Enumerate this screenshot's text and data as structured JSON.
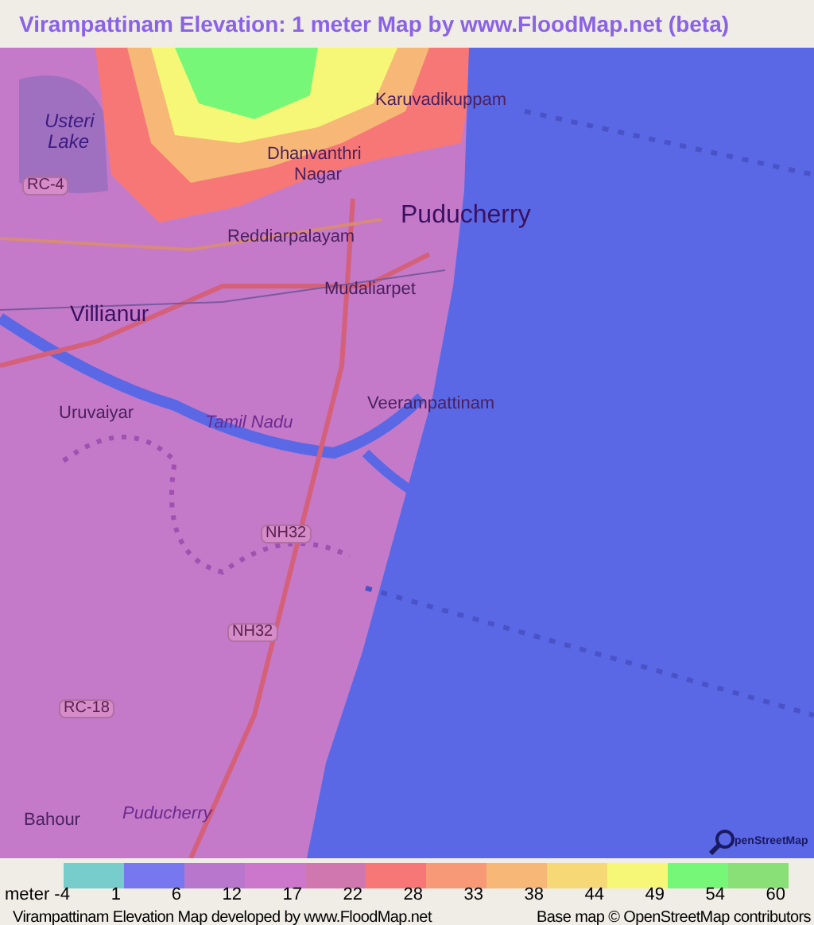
{
  "title": "Virampattinam Elevation: 1 meter Map by www.FloodMap.net (beta)",
  "map": {
    "labels": [
      {
        "text": "Usteri",
        "kind": "water"
      },
      {
        "text": "Lake",
        "kind": "water"
      },
      {
        "text": "Karuvadikuppam",
        "kind": "place"
      },
      {
        "text": "Dhanvanthri",
        "kind": "place"
      },
      {
        "text": "Nagar",
        "kind": "place"
      },
      {
        "text": "RC-4",
        "kind": "road"
      },
      {
        "text": "Puducherry",
        "kind": "city"
      },
      {
        "text": "Reddiarpalayam",
        "kind": "place"
      },
      {
        "text": "Mudaliarpet",
        "kind": "place"
      },
      {
        "text": "Villianur",
        "kind": "town"
      },
      {
        "text": "Veerampattinam",
        "kind": "place"
      },
      {
        "text": "Uruvaiyar",
        "kind": "place"
      },
      {
        "text": "Tamil Nadu",
        "kind": "region"
      },
      {
        "text": "NH32",
        "kind": "road"
      },
      {
        "text": "NH32",
        "kind": "road"
      },
      {
        "text": "RC-18",
        "kind": "road"
      },
      {
        "text": "Bahour",
        "kind": "place"
      },
      {
        "text": "Puducherry",
        "kind": "region"
      }
    ],
    "logo_text": "penStreetMap"
  },
  "legend": {
    "swatches": [
      {
        "color": "#76cdcb"
      },
      {
        "color": "#7777f0"
      },
      {
        "color": "#b877cc"
      },
      {
        "color": "#cc77cc"
      },
      {
        "color": "#d177b0"
      },
      {
        "color": "#f77777"
      },
      {
        "color": "#f79877"
      },
      {
        "color": "#f7b877"
      },
      {
        "color": "#f7d877"
      },
      {
        "color": "#f7f777"
      },
      {
        "color": "#77f777"
      },
      {
        "color": "#89e077"
      }
    ],
    "ticks": [
      "meter -4",
      "1",
      "6",
      "12",
      "17",
      "22",
      "28",
      "33",
      "38",
      "44",
      "49",
      "54",
      "60"
    ]
  },
  "footer": {
    "left": "Virampattinam Elevation Map developed by www.FloodMap.net",
    "right": "Base map © OpenStreetMap contributors"
  }
}
